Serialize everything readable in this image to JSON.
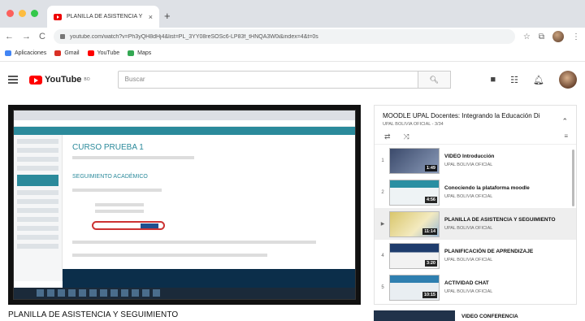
{
  "browser": {
    "tab_title": "PLANILLA DE ASISTENCIA Y S",
    "tab_close": "×",
    "new_tab": "+",
    "url": "youtube.com/watch?v=Ph3yQH8dHj4&list=PL_3YY08reSOSc6-LP83f_tHNQA3W0i&index=4&t=0s",
    "bookmarks": [
      {
        "label": "Aplicaciones",
        "color": "#4285f4"
      },
      {
        "label": "Gmail",
        "color": "#d93025"
      },
      {
        "label": "YouTube",
        "color": "#ff0000"
      },
      {
        "label": "Maps",
        "color": "#34a853"
      }
    ]
  },
  "youtube": {
    "logo_text": "YouTube",
    "logo_country": "BO",
    "search_placeholder": "Buscar"
  },
  "player_screen": {
    "course_title": "CURSO PRUEBA 1",
    "section_title": "SEGUIMIENTO ACADÉMICO"
  },
  "video": {
    "title": "PLANILLA DE ASISTENCIA Y SEGUIMIENTO"
  },
  "playlist": {
    "title": "MOODLE UPAL Docentes: Integrando la Educación Di",
    "channel": "UPAL BOLIVIA OFICIAL - 3/34",
    "items": [
      {
        "index": "1",
        "title": "VIDEO Introducción",
        "channel": "UPAL BOLIVIA OFICIAL",
        "duration": "1:49",
        "thumb": "#3b4a6b"
      },
      {
        "index": "2",
        "title": "Conociendo la plataforma moodle",
        "channel": "UPAL BOLIVIA OFICIAL",
        "duration": "4:56",
        "thumb": "#2a8fa2"
      },
      {
        "index": "▶",
        "title": "PLANILLA DE ASISTENCIA Y SEGUIMIENTO",
        "channel": "UPAL BOLIVIA OFICIAL",
        "duration": "11:14",
        "thumb": "#d9c66b"
      },
      {
        "index": "4",
        "title": "PLANIFICACIÓN DE APRENDIZAJE",
        "channel": "UPAL BOLIVIA OFICIAL",
        "duration": "3:20",
        "thumb": "#1f3d6d"
      },
      {
        "index": "5",
        "title": "ACTIVIDAD CHAT",
        "channel": "UPAL BOLIVIA OFICIAL",
        "duration": "10:15",
        "thumb": "#2f7fb0"
      }
    ],
    "active_index": 2
  },
  "next_item": {
    "title": "VIDEO CONFERENCIA"
  }
}
